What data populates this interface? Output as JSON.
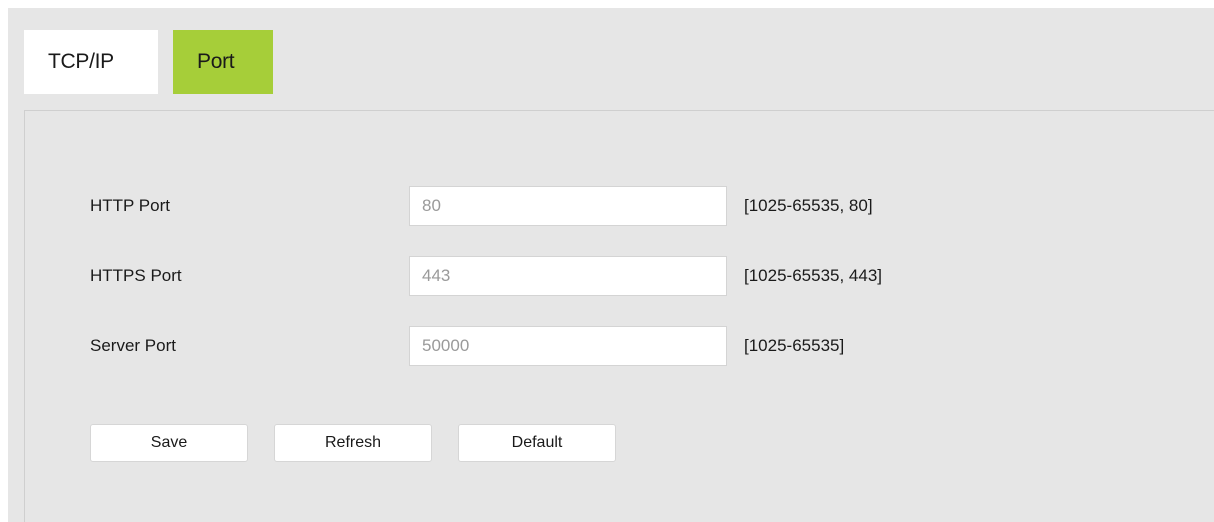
{
  "tabs": [
    {
      "label": "TCP/IP",
      "active": false
    },
    {
      "label": "Port",
      "active": true
    }
  ],
  "accent_color": "#a6ce39",
  "fields": [
    {
      "label": "HTTP Port",
      "value": "80",
      "range": "[1025-65535, 80]"
    },
    {
      "label": "HTTPS Port",
      "value": "443",
      "range": "[1025-65535, 443]"
    },
    {
      "label": "Server Port",
      "value": "50000",
      "range": "[1025-65535]"
    }
  ],
  "buttons": {
    "save": "Save",
    "refresh": "Refresh",
    "default": "Default"
  }
}
